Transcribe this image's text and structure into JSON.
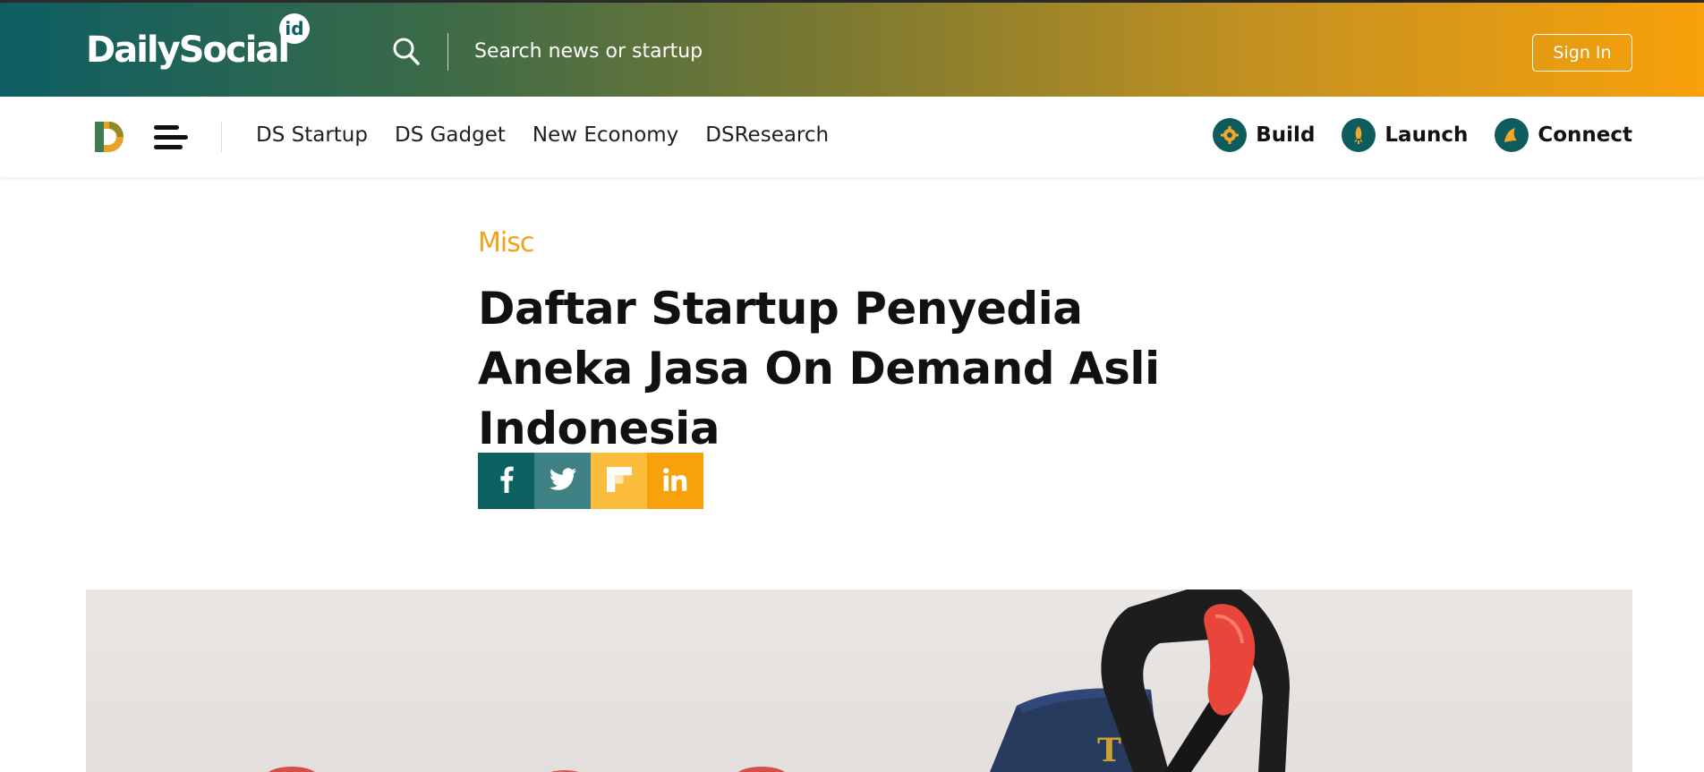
{
  "header": {
    "logo_text": "DailySocial",
    "logo_badge": "id",
    "search_placeholder": "Search news or startup",
    "signin_label": "Sign In"
  },
  "nav": {
    "links": [
      "DS Startup",
      "DS Gadget",
      "New Economy",
      "DSResearch"
    ],
    "right_links": [
      {
        "label": "Build",
        "icon": "build-icon"
      },
      {
        "label": "Launch",
        "icon": "launch-icon"
      },
      {
        "label": "Connect",
        "icon": "connect-icon"
      }
    ]
  },
  "article": {
    "category": "Misc",
    "title": "Daftar Startup Penyedia Aneka Jasa On Demand Asli Indonesia",
    "share": [
      "facebook-icon",
      "twitter-icon",
      "flipboard-icon",
      "linkedin-icon"
    ]
  },
  "hero": {
    "book_text": "T"
  },
  "colors": {
    "teal": "#0d5e63",
    "orange": "#f8a10a",
    "category": "#f5a01c"
  }
}
